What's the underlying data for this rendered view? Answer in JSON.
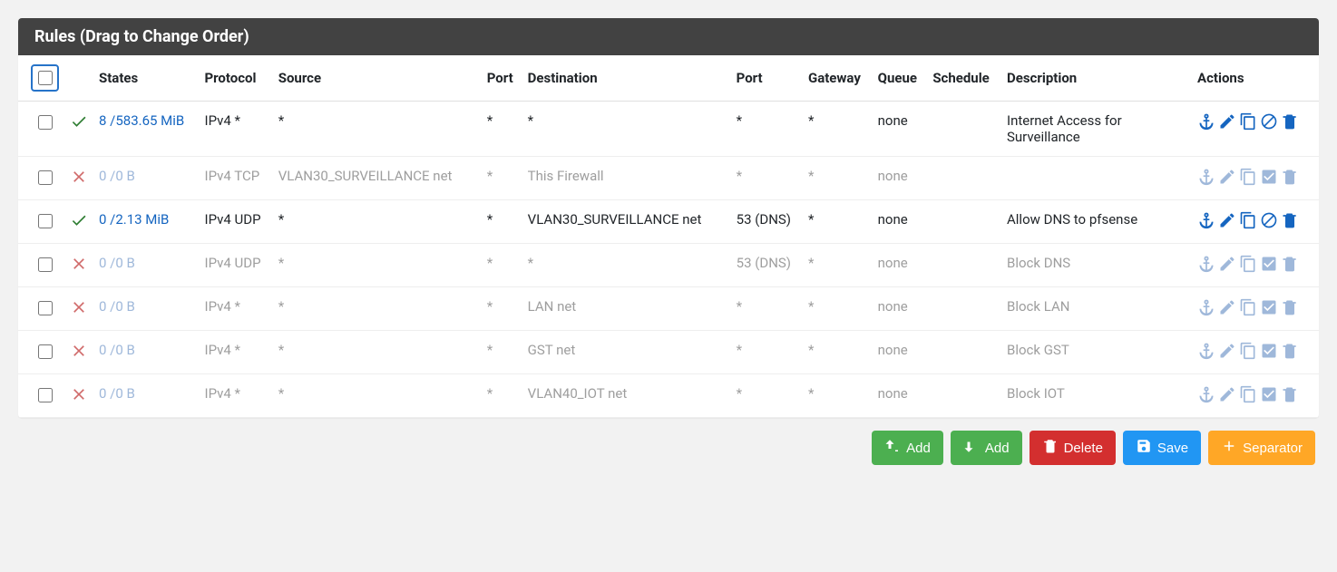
{
  "panel_title": "Rules (Drag to Change Order)",
  "columns": {
    "states": "States",
    "protocol": "Protocol",
    "source": "Source",
    "port_src": "Port",
    "destination": "Destination",
    "port_dst": "Port",
    "gateway": "Gateway",
    "queue": "Queue",
    "schedule": "Schedule",
    "description": "Description",
    "actions": "Actions"
  },
  "rules": [
    {
      "status": "pass",
      "disabled": false,
      "states": "8 /583.65 MiB",
      "protocol": "IPv4 *",
      "source": "*",
      "port_src": "*",
      "destination": "*",
      "port_dst": "*",
      "gateway": "*",
      "queue": "none",
      "schedule": "",
      "description": "Internet Access for Surveillance",
      "action_set": "enabled"
    },
    {
      "status": "block",
      "disabled": true,
      "states": "0 /0 B",
      "protocol": "IPv4 TCP",
      "source": "VLAN30_SURVEILLANCE net",
      "port_src": "*",
      "destination": "This Firewall",
      "port_dst": "*",
      "gateway": "*",
      "queue": "none",
      "schedule": "",
      "description": "",
      "action_set": "disabled"
    },
    {
      "status": "pass",
      "disabled": false,
      "states": "0 /2.13 MiB",
      "protocol": "IPv4 UDP",
      "source": "*",
      "port_src": "*",
      "destination": "VLAN30_SURVEILLANCE net",
      "port_dst": "53 (DNS)",
      "gateway": "*",
      "queue": "none",
      "schedule": "",
      "description": "Allow DNS to pfsense",
      "action_set": "enabled"
    },
    {
      "status": "block",
      "disabled": true,
      "states": "0 /0 B",
      "protocol": "IPv4 UDP",
      "source": "*",
      "port_src": "*",
      "destination": "*",
      "port_dst": "53 (DNS)",
      "gateway": "*",
      "queue": "none",
      "schedule": "",
      "description": "Block DNS",
      "action_set": "disabled"
    },
    {
      "status": "block",
      "disabled": true,
      "states": "0 /0 B",
      "protocol": "IPv4 *",
      "source": "*",
      "port_src": "*",
      "destination": "LAN net",
      "port_dst": "*",
      "gateway": "*",
      "queue": "none",
      "schedule": "",
      "description": "Block LAN",
      "action_set": "disabled"
    },
    {
      "status": "block",
      "disabled": true,
      "states": "0 /0 B",
      "protocol": "IPv4 *",
      "source": "*",
      "port_src": "*",
      "destination": "GST net",
      "port_dst": "*",
      "gateway": "*",
      "queue": "none",
      "schedule": "",
      "description": "Block GST",
      "action_set": "disabled"
    },
    {
      "status": "block",
      "disabled": true,
      "states": "0 /0 B",
      "protocol": "IPv4 *",
      "source": "*",
      "port_src": "*",
      "destination": "VLAN40_IOT net",
      "port_dst": "*",
      "gateway": "*",
      "queue": "none",
      "schedule": "",
      "description": "Block IOT",
      "action_set": "disabled"
    }
  ],
  "buttons": {
    "add_top": "Add",
    "add_bottom": "Add",
    "delete": "Delete",
    "save": "Save",
    "separator": "Separator"
  }
}
